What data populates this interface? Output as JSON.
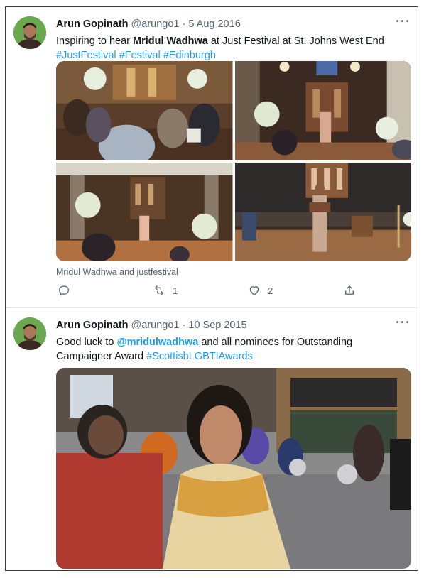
{
  "tweets": [
    {
      "author": "Arun Gopinath",
      "handle": "@arungo1",
      "sep": "·",
      "date": "5 Aug 2016",
      "more": "···",
      "text_before": "Inspiring to hear ",
      "text_bold": "Mridul Wadhwa",
      "text_after": " at Just Festival at St. Johns West End",
      "hashtags": [
        "#JustFestival",
        "#Festival",
        "#Edinburgh"
      ],
      "caption": "Mridul Wadhwa and justfestival",
      "retweets": "1",
      "likes": "2"
    },
    {
      "author": "Arun Gopinath",
      "handle": "@arungo1",
      "sep": "·",
      "date": "10 Sep 2015",
      "more": "···",
      "text_before": "Good luck to ",
      "mention": "@mridulwadhwa",
      "text_after": " and all nominees for Outstanding Campaigner Award ",
      "hashtag": "#ScottishLGBTIAwards"
    }
  ],
  "colors": {
    "link": "#1d9bf0",
    "secondary_text": "#536471",
    "avatar_bg": "#6aa84f"
  }
}
